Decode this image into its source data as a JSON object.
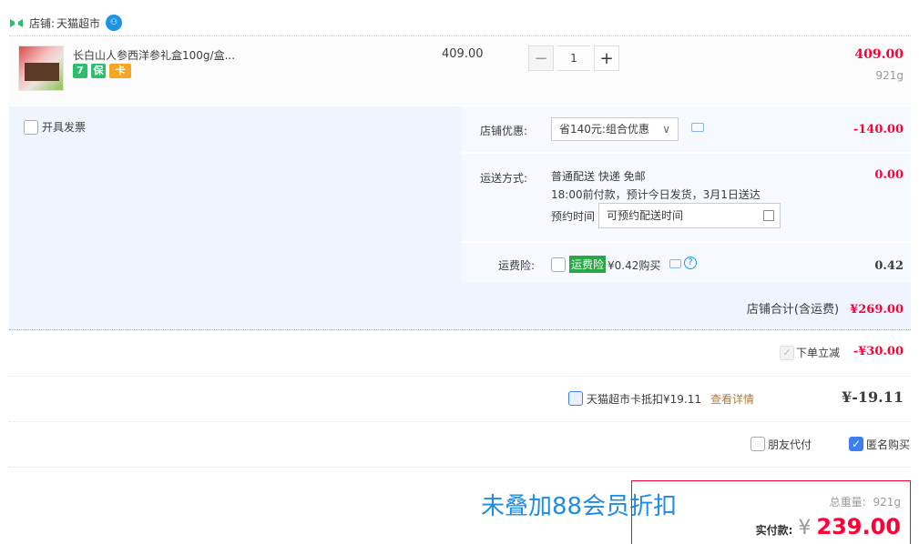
{
  "shop": {
    "label": "店铺:",
    "name": "天猫超市"
  },
  "item": {
    "title": "长白山人参西洋参礼盒100g/盒...",
    "badges": [
      "7",
      "保",
      "卡"
    ],
    "price": "409.00",
    "quantity": "1",
    "subtotal": "409.00",
    "weight": "921g"
  },
  "invoice": {
    "label": "开具发票"
  },
  "discount": {
    "label": "店铺优惠:",
    "selected": "省140元:组合优惠",
    "value": "-140.00"
  },
  "delivery": {
    "label": "运送方式:",
    "line1": "普通配送 快递 免邮",
    "line2": "18:00前付款，预计今日发货，3月1日送达",
    "reserve_label": "预约时间",
    "reserve_placeholder": "可预约配送时间",
    "value": "0.00"
  },
  "insurance": {
    "label": "运费险:",
    "tag": "运费险",
    "text": "¥0.42购买",
    "value": "0.42"
  },
  "shop_total": {
    "label": "店铺合计(含运费)",
    "value": "¥269.00"
  },
  "instant_discount": {
    "label": "下单立减",
    "value": "-¥30.00"
  },
  "card": {
    "label": "天猫超市卡抵扣¥19.11",
    "link": "查看详情",
    "value": "¥-19.11"
  },
  "pay_options": {
    "friend_pay": "朋友代付",
    "anonymous": "匿名购买"
  },
  "promo": "未叠加88会员折扣",
  "summary": {
    "weight_label": "总重量:",
    "weight": "921g",
    "pay_label": "实付款:",
    "currency": "¥",
    "amount": "239.00"
  },
  "colors": {
    "accent_red": "#ff0036",
    "panel_blue": "#eff4ff",
    "link_blue": "#1c8ce6"
  }
}
